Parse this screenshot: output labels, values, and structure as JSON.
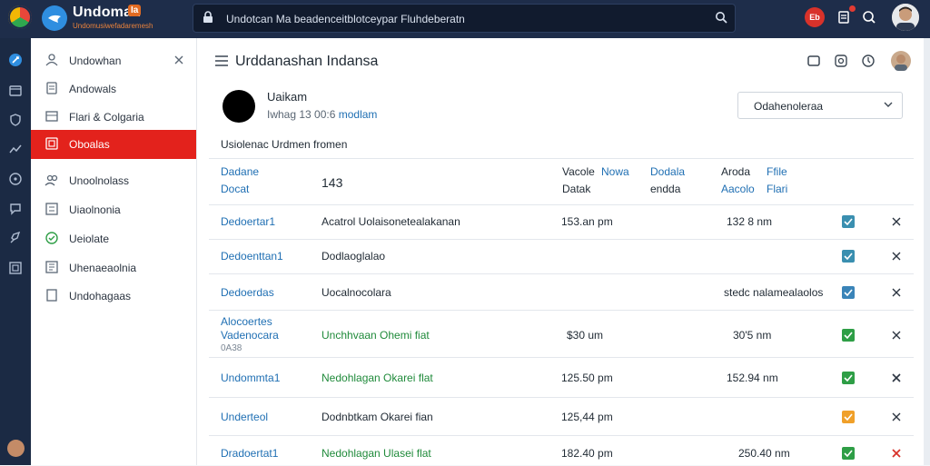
{
  "topbar": {
    "brand_title": "Undoman",
    "brand_badge": "Ia",
    "brand_sub": "Undomusiwefadaremesh",
    "search_value": "Undotcan Ma beadenceitblotceypar Fluhdeberatn",
    "badge_label": "Eb",
    "icons": [
      "app-logo-icon",
      "brand-bird-icon",
      "lock-icon",
      "search-icon",
      "alert-badge-icon",
      "notification-icon",
      "help-icon",
      "user-avatar"
    ]
  },
  "rail": {
    "icons": [
      "rocket-icon",
      "box-icon",
      "shield-icon",
      "chart-icon",
      "compass-icon",
      "chat-icon",
      "launch-icon",
      "layers-icon"
    ]
  },
  "sidebar": {
    "items": [
      {
        "label": "Undowhan",
        "icon": "person-icon"
      },
      {
        "label": "Andowals",
        "icon": "document-icon"
      },
      {
        "label": "Flari & Colgaria",
        "icon": "folder-icon"
      },
      {
        "label": "Oboalas",
        "icon": "grid-icon"
      },
      {
        "label": "Unoolnolass",
        "icon": "users-icon"
      },
      {
        "label": "Uiaolnonia",
        "icon": "list-icon"
      },
      {
        "label": "Ueiolate",
        "icon": "check-circle-icon"
      },
      {
        "label": "Uhenaeaolnia",
        "icon": "doc-lines-icon"
      },
      {
        "label": "Undohagaas",
        "icon": "page-icon"
      }
    ]
  },
  "main": {
    "title": "Urddanashan Indansa",
    "profile": {
      "name": "Uaikam",
      "meta_prefix": "Iwhag 13 00:6",
      "meta_link": "modlam"
    },
    "dropdown_value": "Odahenoleraa",
    "section_label": "Usiolenac Urdmen fromen",
    "headers": {
      "col1": [
        "Dadane",
        "Docat"
      ],
      "col2": "143",
      "col3": [
        "Vacole",
        "Datak"
      ],
      "col3b": "Nowa",
      "col4": [
        "Dodala",
        "endda"
      ],
      "col5": [
        "Aroda",
        "Aacolo"
      ],
      "col6": [
        "Ffile",
        "Flari"
      ]
    },
    "rows": [
      {
        "id": "Dedoertar1",
        "desc": "Acatrol Uolaisonetealakanan",
        "v1": "153.an pm",
        "v2": "132 8   nm",
        "check": "teal",
        "x_color": "dark"
      },
      {
        "id": "Dedoenttan1",
        "desc": "Dodlaoglalao",
        "v1": "",
        "v2": "",
        "check": "teal",
        "x_color": "dark"
      },
      {
        "id": "Dedoerdas",
        "desc": "Uocalnocolara",
        "v1": "",
        "v2": "stedc nalamealaolos",
        "check": "blue",
        "x_color": "dark"
      },
      {
        "id": "Alocoertes",
        "id2": "Vadenocara",
        "id3": "0A38",
        "desc": "Unchhvaan Ohemi  fiat",
        "desc_green": true,
        "v1": "$30   um",
        "v2": "30'5   nm",
        "check": "green",
        "x_color": "dark"
      },
      {
        "id": "Undommta1",
        "desc": "Nedohlagan Okarei  flat",
        "desc_green": true,
        "v1": "125.50 pm",
        "v2": "152.94   nm",
        "check": "green",
        "x_color": "dark"
      },
      {
        "id": "Underteol",
        "desc": "Dodnbtkam Okarei  fian",
        "desc_green": false,
        "v1": "125,44 pm",
        "v2": "",
        "check": "orange",
        "x_color": "dark"
      },
      {
        "id": "Dradoertat1",
        "desc": "Nedohlagan Ulasei  flat",
        "desc_green": true,
        "v1": "182.40 pm",
        "v2": "250.40 nm",
        "check": "green",
        "x_color": "red"
      }
    ],
    "colors": {
      "active": "#e3221c",
      "teal": "#3a8fb0",
      "blue": "#3a84b8",
      "green": "#2e9e46",
      "orange": "#f0a02a"
    }
  }
}
